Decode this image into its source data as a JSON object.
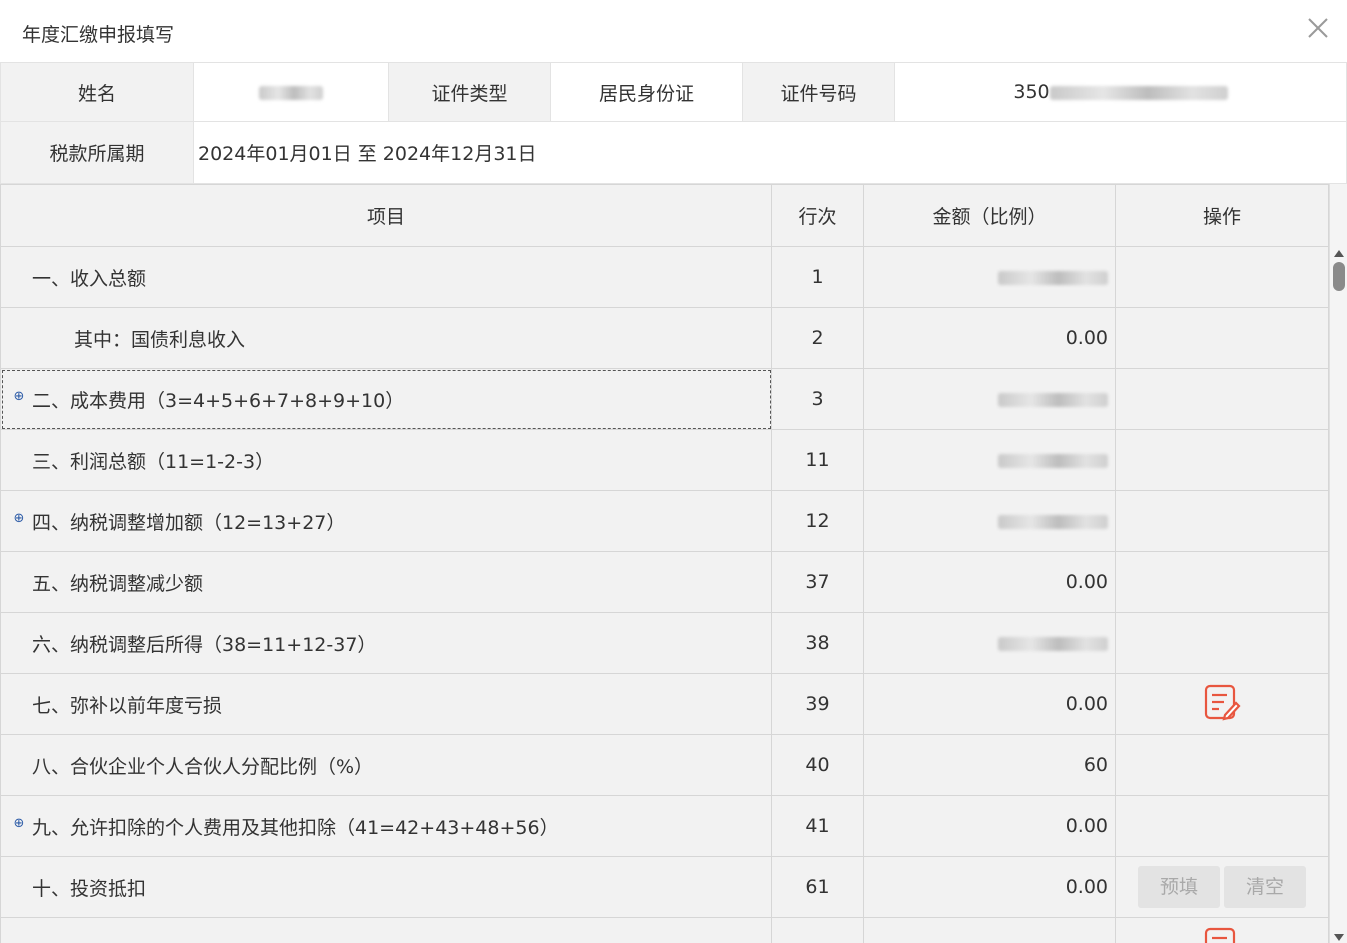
{
  "window": {
    "title": "年度汇缴申报填写",
    "close_icon": "close-icon"
  },
  "info": {
    "name_label": "姓名",
    "id_type_label": "证件类型",
    "id_type_value": "居民身份证",
    "id_no_label": "证件号码",
    "id_no_visible_prefix": "350",
    "period_label": "税款所属期",
    "period_value": "2024年01月01日 至 2024年12月31日"
  },
  "table": {
    "headers": {
      "item": "项目",
      "row": "行次",
      "amount": "金额（比例）",
      "op": "操作"
    },
    "rows": [
      {
        "item": "一、收入总额",
        "row": "1",
        "amount": "",
        "amount_redacted": true,
        "expandable": false,
        "indent": false
      },
      {
        "item": "其中：国债利息收入",
        "row": "2",
        "amount": "0.00",
        "expandable": false,
        "indent": true
      },
      {
        "item": "二、成本费用（3=4+5+6+7+8+9+10）",
        "row": "3",
        "amount": "",
        "amount_redacted": true,
        "expandable": true,
        "indent": false,
        "selected": true
      },
      {
        "item": "三、利润总额（11=1-2-3）",
        "row": "11",
        "amount": "",
        "amount_redacted": true,
        "expandable": false,
        "indent": false
      },
      {
        "item": "四、纳税调整增加额（12=13+27）",
        "row": "12",
        "amount": "",
        "amount_redacted": true,
        "expandable": true,
        "indent": false
      },
      {
        "item": "五、纳税调整减少额",
        "row": "37",
        "amount": "0.00",
        "expandable": false,
        "indent": false
      },
      {
        "item": "六、纳税调整后所得（38=11+12-37）",
        "row": "38",
        "amount": "",
        "amount_redacted": true,
        "expandable": false,
        "indent": false
      },
      {
        "item": "七、弥补以前年度亏损",
        "row": "39",
        "amount": "0.00",
        "expandable": false,
        "indent": false,
        "op": "edit"
      },
      {
        "item": "八、合伙企业个人合伙人分配比例（%）",
        "row": "40",
        "amount": "60",
        "expandable": false,
        "indent": false
      },
      {
        "item": "九、允许扣除的个人费用及其他扣除（41=42+43+48+56）",
        "row": "41",
        "amount": "0.00",
        "expandable": true,
        "indent": false
      },
      {
        "item": "十、投资抵扣",
        "row": "61",
        "amount": "0.00",
        "expandable": false,
        "indent": false,
        "op": "buttons"
      }
    ],
    "buttons": {
      "prefill": "预填",
      "clear": "清空"
    }
  },
  "colors": {
    "accent_icon": "#e8563f",
    "header_bg": "#f2f2f2",
    "expander": "#2b5aa6"
  }
}
